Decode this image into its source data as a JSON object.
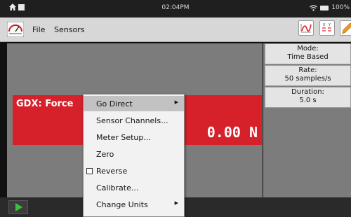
{
  "status": {
    "time": "02:04PM",
    "battery": "100%"
  },
  "appbar": {
    "file_label": "File",
    "sensors_label": "Sensors",
    "graph_icon": "graph-icon",
    "table_icon": "table-icon",
    "pencil_icon": "pencil-icon"
  },
  "info": {
    "mode_label": "Mode:",
    "mode_value": "Time Based",
    "rate_label": "Rate:",
    "rate_value": "50 samples/s",
    "duration_label": "Duration:",
    "duration_value": "5.0 s"
  },
  "meter": {
    "label": "GDX: Force",
    "value": "0.00 N",
    "color": "#d6212b"
  },
  "context_menu": {
    "items": [
      {
        "label": "Go Direct",
        "submenu": true
      },
      {
        "label": "Sensor Channels...",
        "submenu": false
      },
      {
        "label": "Meter Setup...",
        "submenu": false
      },
      {
        "label": "Zero",
        "submenu": false
      },
      {
        "label": "Reverse",
        "submenu": false,
        "checkbox": true,
        "checked": false
      },
      {
        "label": "Calibrate...",
        "submenu": false
      },
      {
        "label": "Change Units",
        "submenu": true
      }
    ]
  },
  "colors": {
    "accent_red": "#d6212b",
    "play_green": "#3fbf3f"
  }
}
